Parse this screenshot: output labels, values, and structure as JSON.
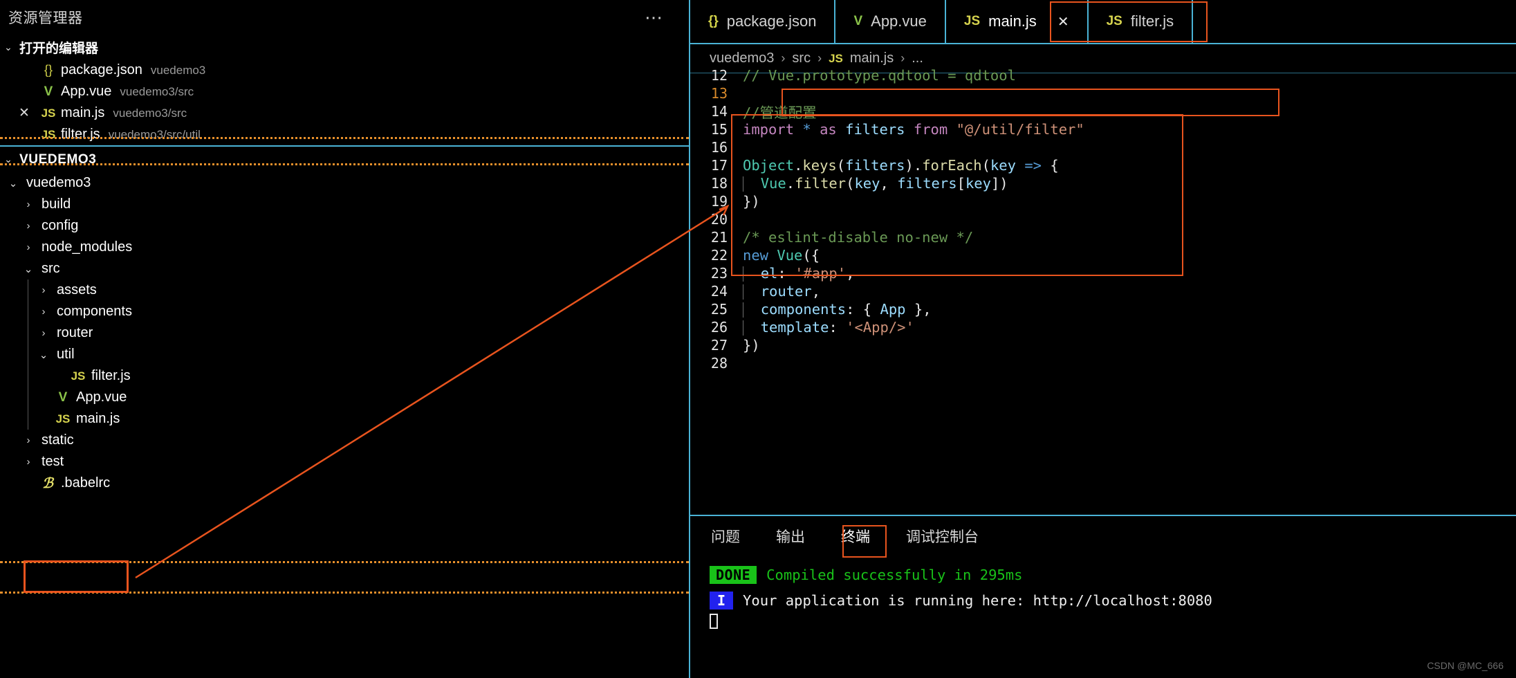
{
  "sidebar": {
    "title": "资源管理器",
    "more_actions_icon": "ellipsis-icon",
    "open_editors": {
      "label": "打开的编辑器",
      "twisty": "⌄",
      "items": [
        {
          "icon": "{}",
          "icon_name": "json-file-icon",
          "name": "package.json",
          "path": "vuedemo3",
          "close": ""
        },
        {
          "icon": "V",
          "icon_name": "vue-file-icon",
          "name": "App.vue",
          "path": "vuedemo3/src",
          "close": ""
        },
        {
          "icon": "JS",
          "icon_name": "js-file-icon",
          "name": "main.js",
          "path": "vuedemo3/src",
          "close": "✕"
        },
        {
          "icon": "JS",
          "icon_name": "js-file-icon",
          "name": "filter.js",
          "path": "vuedemo3/src/util",
          "close": ""
        }
      ]
    },
    "workspace": {
      "label": "VUEDEMO3",
      "twisty": "⌄",
      "tree": [
        {
          "label": "vuedemo3",
          "arrow": "⌄",
          "depth": 0,
          "type": "folder",
          "icon": "",
          "icon_name": "folder-icon"
        },
        {
          "label": "build",
          "arrow": "›",
          "depth": 1,
          "type": "folder",
          "icon": "",
          "icon_name": "folder-icon"
        },
        {
          "label": "config",
          "arrow": "›",
          "depth": 1,
          "type": "folder",
          "icon": "",
          "icon_name": "folder-icon"
        },
        {
          "label": "node_modules",
          "arrow": "›",
          "depth": 1,
          "type": "folder",
          "icon": "",
          "icon_name": "folder-icon"
        },
        {
          "label": "src",
          "arrow": "⌄",
          "depth": 1,
          "type": "folder",
          "icon": "",
          "icon_name": "folder-icon"
        },
        {
          "label": "assets",
          "arrow": "›",
          "depth": 2,
          "type": "folder",
          "icon": "",
          "icon_name": "folder-icon"
        },
        {
          "label": "components",
          "arrow": "›",
          "depth": 2,
          "type": "folder",
          "icon": "",
          "icon_name": "folder-icon"
        },
        {
          "label": "router",
          "arrow": "›",
          "depth": 2,
          "type": "folder",
          "icon": "",
          "icon_name": "folder-icon"
        },
        {
          "label": "util",
          "arrow": "⌄",
          "depth": 2,
          "type": "folder",
          "icon": "",
          "icon_name": "folder-icon"
        },
        {
          "label": "filter.js",
          "arrow": "",
          "depth": 3,
          "type": "js",
          "icon": "JS",
          "icon_name": "js-file-icon"
        },
        {
          "label": "App.vue",
          "arrow": "",
          "depth": 2,
          "type": "vue",
          "icon": "V",
          "icon_name": "vue-file-icon"
        },
        {
          "label": "main.js",
          "arrow": "",
          "depth": 2,
          "type": "js",
          "icon": "JS",
          "icon_name": "js-file-icon"
        },
        {
          "label": "static",
          "arrow": "›",
          "depth": 1,
          "type": "folder",
          "icon": "",
          "icon_name": "folder-icon"
        },
        {
          "label": "test",
          "arrow": "›",
          "depth": 1,
          "type": "folder",
          "icon": "",
          "icon_name": "folder-icon"
        },
        {
          "label": ".babelrc",
          "arrow": "",
          "depth": 1,
          "type": "babel",
          "icon": "B",
          "icon_name": "babel-file-icon"
        }
      ]
    }
  },
  "editor": {
    "tabs": [
      {
        "icon": "{}",
        "icon_name": "json-file-icon",
        "label": "package.json",
        "active": false,
        "close": ""
      },
      {
        "icon": "V",
        "icon_name": "vue-file-icon",
        "label": "App.vue",
        "active": false,
        "close": ""
      },
      {
        "icon": "JS",
        "icon_name": "js-file-icon",
        "label": "main.js",
        "active": true,
        "close": "✕"
      },
      {
        "icon": "JS",
        "icon_name": "js-file-icon",
        "label": "filter.js",
        "active": false,
        "close": ""
      }
    ],
    "breadcrumb": {
      "root": "vuedemo3",
      "sep": "›",
      "folder": "src",
      "file_icon": "JS",
      "file": "main.js",
      "more": "..."
    },
    "code": [
      {
        "num": "12",
        "active": false,
        "tokens": [
          {
            "t": "// Vue.prototype.qdtool = qdtool",
            "c": "t-comment"
          }
        ]
      },
      {
        "num": "13",
        "active": true,
        "tokens": []
      },
      {
        "num": "14",
        "active": false,
        "tokens": [
          {
            "t": "//管道配置",
            "c": "t-comment"
          }
        ]
      },
      {
        "num": "15",
        "active": false,
        "tokens": [
          {
            "t": "import",
            "c": "t-keyword"
          },
          {
            "t": " ",
            "c": "t-plain"
          },
          {
            "t": "*",
            "c": "t-op"
          },
          {
            "t": " ",
            "c": "t-plain"
          },
          {
            "t": "as",
            "c": "t-keyword"
          },
          {
            "t": " ",
            "c": "t-plain"
          },
          {
            "t": "filters",
            "c": "t-var"
          },
          {
            "t": " ",
            "c": "t-plain"
          },
          {
            "t": "from",
            "c": "t-keyword"
          },
          {
            "t": " ",
            "c": "t-plain"
          },
          {
            "t": "\"@/util/filter\"",
            "c": "t-string"
          }
        ]
      },
      {
        "num": "16",
        "active": false,
        "tokens": []
      },
      {
        "num": "17",
        "active": false,
        "tokens": [
          {
            "t": "Object",
            "c": "t-class"
          },
          {
            "t": ".",
            "c": "t-plain"
          },
          {
            "t": "keys",
            "c": "t-func"
          },
          {
            "t": "(",
            "c": "t-plain"
          },
          {
            "t": "filters",
            "c": "t-var"
          },
          {
            "t": ").",
            "c": "t-plain"
          },
          {
            "t": "forEach",
            "c": "t-func"
          },
          {
            "t": "(",
            "c": "t-plain"
          },
          {
            "t": "key",
            "c": "t-var"
          },
          {
            "t": " ",
            "c": "t-plain"
          },
          {
            "t": "=>",
            "c": "t-op"
          },
          {
            "t": " {",
            "c": "t-plain"
          }
        ]
      },
      {
        "num": "18",
        "active": false,
        "indent": 1,
        "tokens": [
          {
            "t": "  ",
            "c": "t-plain"
          },
          {
            "t": "Vue",
            "c": "t-class"
          },
          {
            "t": ".",
            "c": "t-plain"
          },
          {
            "t": "filter",
            "c": "t-func"
          },
          {
            "t": "(",
            "c": "t-plain"
          },
          {
            "t": "key",
            "c": "t-var"
          },
          {
            "t": ", ",
            "c": "t-plain"
          },
          {
            "t": "filters",
            "c": "t-var"
          },
          {
            "t": "[",
            "c": "t-plain"
          },
          {
            "t": "key",
            "c": "t-var"
          },
          {
            "t": "])",
            "c": "t-plain"
          }
        ]
      },
      {
        "num": "19",
        "active": false,
        "tokens": [
          {
            "t": "})",
            "c": "t-plain"
          }
        ]
      },
      {
        "num": "20",
        "active": false,
        "tokens": []
      },
      {
        "num": "21",
        "active": false,
        "tokens": [
          {
            "t": "/* eslint-disable no-new */",
            "c": "t-comment"
          }
        ]
      },
      {
        "num": "22",
        "active": false,
        "tokens": [
          {
            "t": "new",
            "c": "t-kw2"
          },
          {
            "t": " ",
            "c": "t-plain"
          },
          {
            "t": "Vue",
            "c": "t-class"
          },
          {
            "t": "({",
            "c": "t-plain"
          }
        ]
      },
      {
        "num": "23",
        "active": false,
        "indent": 1,
        "tokens": [
          {
            "t": "  ",
            "c": "t-plain"
          },
          {
            "t": "el",
            "c": "t-var"
          },
          {
            "t": ": ",
            "c": "t-plain"
          },
          {
            "t": "'#app'",
            "c": "t-string"
          },
          {
            "t": ",",
            "c": "t-plain"
          }
        ]
      },
      {
        "num": "24",
        "active": false,
        "indent": 1,
        "tokens": [
          {
            "t": "  ",
            "c": "t-plain"
          },
          {
            "t": "router",
            "c": "t-var"
          },
          {
            "t": ",",
            "c": "t-plain"
          }
        ]
      },
      {
        "num": "25",
        "active": false,
        "indent": 1,
        "tokens": [
          {
            "t": "  ",
            "c": "t-plain"
          },
          {
            "t": "components",
            "c": "t-var"
          },
          {
            "t": ": { ",
            "c": "t-plain"
          },
          {
            "t": "App",
            "c": "t-var"
          },
          {
            "t": " },",
            "c": "t-plain"
          }
        ]
      },
      {
        "num": "26",
        "active": false,
        "indent": 1,
        "tokens": [
          {
            "t": "  ",
            "c": "t-plain"
          },
          {
            "t": "template",
            "c": "t-var"
          },
          {
            "t": ": ",
            "c": "t-plain"
          },
          {
            "t": "'<App/>'",
            "c": "t-string"
          }
        ]
      },
      {
        "num": "27",
        "active": false,
        "tokens": [
          {
            "t": "})",
            "c": "t-plain"
          }
        ]
      },
      {
        "num": "28",
        "active": false,
        "tokens": []
      }
    ]
  },
  "panel": {
    "tabs": [
      {
        "label": "问题",
        "active": false
      },
      {
        "label": "输出",
        "active": false
      },
      {
        "label": "终端",
        "active": true
      },
      {
        "label": "调试控制台",
        "active": false
      }
    ],
    "terminal": {
      "done_badge": "DONE",
      "done_text": "Compiled successfully in 295ms",
      "info_badge": "I",
      "info_text": "Your application is running here: http://localhost:8080"
    }
  },
  "annotations": {
    "colors": {
      "box": "#e8541e",
      "dashed": "#e8902b",
      "tab_border": "#4ab3d6"
    }
  },
  "watermark": "CSDN @MC_666"
}
